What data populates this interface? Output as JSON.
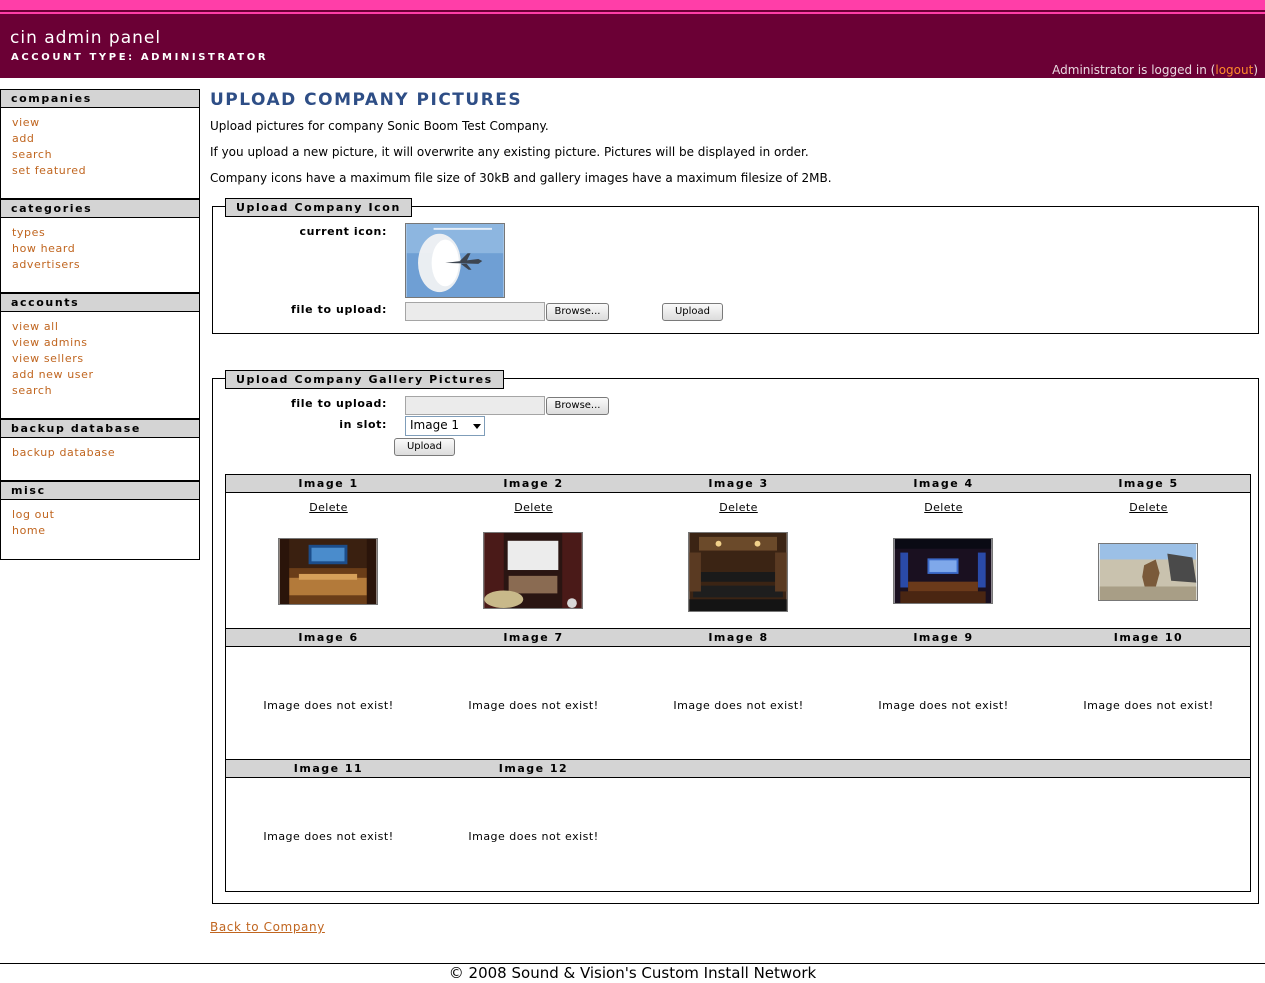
{
  "header": {
    "title": "cin admin panel",
    "account_type": "ACCOUNT TYPE: ADMINISTRATOR",
    "logged_prefix": "Administrator is logged in (",
    "logout_label": "logout",
    "logged_suffix": ")"
  },
  "sidebar": [
    {
      "title": "companies",
      "links": [
        "view",
        "add",
        "search",
        "set featured"
      ]
    },
    {
      "title": "categories",
      "links": [
        "types",
        "how heard",
        "advertisers"
      ]
    },
    {
      "title": "accounts",
      "links": [
        "view all",
        "view admins",
        "view sellers",
        "add new user",
        "search"
      ]
    },
    {
      "title": "backup database",
      "links": [
        "backup database"
      ]
    },
    {
      "title": "misc",
      "links": [
        "log out",
        "home"
      ]
    }
  ],
  "main": {
    "title": "UPLOAD COMPANY PICTURES",
    "intro": [
      "Upload pictures for company Sonic Boom Test Company.",
      "If you upload a new picture, it will overwrite any existing picture. Pictures will be displayed in order.",
      "Company icons have a maximum file size of 30kB and gallery images have a maximum filesize of 2MB."
    ],
    "icon_section": {
      "legend": "Upload Company Icon",
      "current_icon_label": "current icon:",
      "file_label": "file to upload:",
      "browse_label": "Browse...",
      "upload_label": "Upload"
    },
    "gallery_section": {
      "legend": "Upload Company Gallery Pictures",
      "file_label": "file to upload:",
      "slot_label": "in slot:",
      "slot_value": "Image 1",
      "browse_label": "Browse...",
      "upload_label": "Upload"
    },
    "gallery": {
      "delete_label": "Delete",
      "missing_label": "Image does not exist!",
      "slots": [
        "Image 1",
        "Image 2",
        "Image 3",
        "Image 4",
        "Image 5",
        "Image 6",
        "Image 7",
        "Image 8",
        "Image 9",
        "Image 10",
        "Image 11",
        "Image 12"
      ]
    },
    "back_link": "Back to Company"
  },
  "footer": "© 2008 Sound & Vision's Custom Install Network"
}
